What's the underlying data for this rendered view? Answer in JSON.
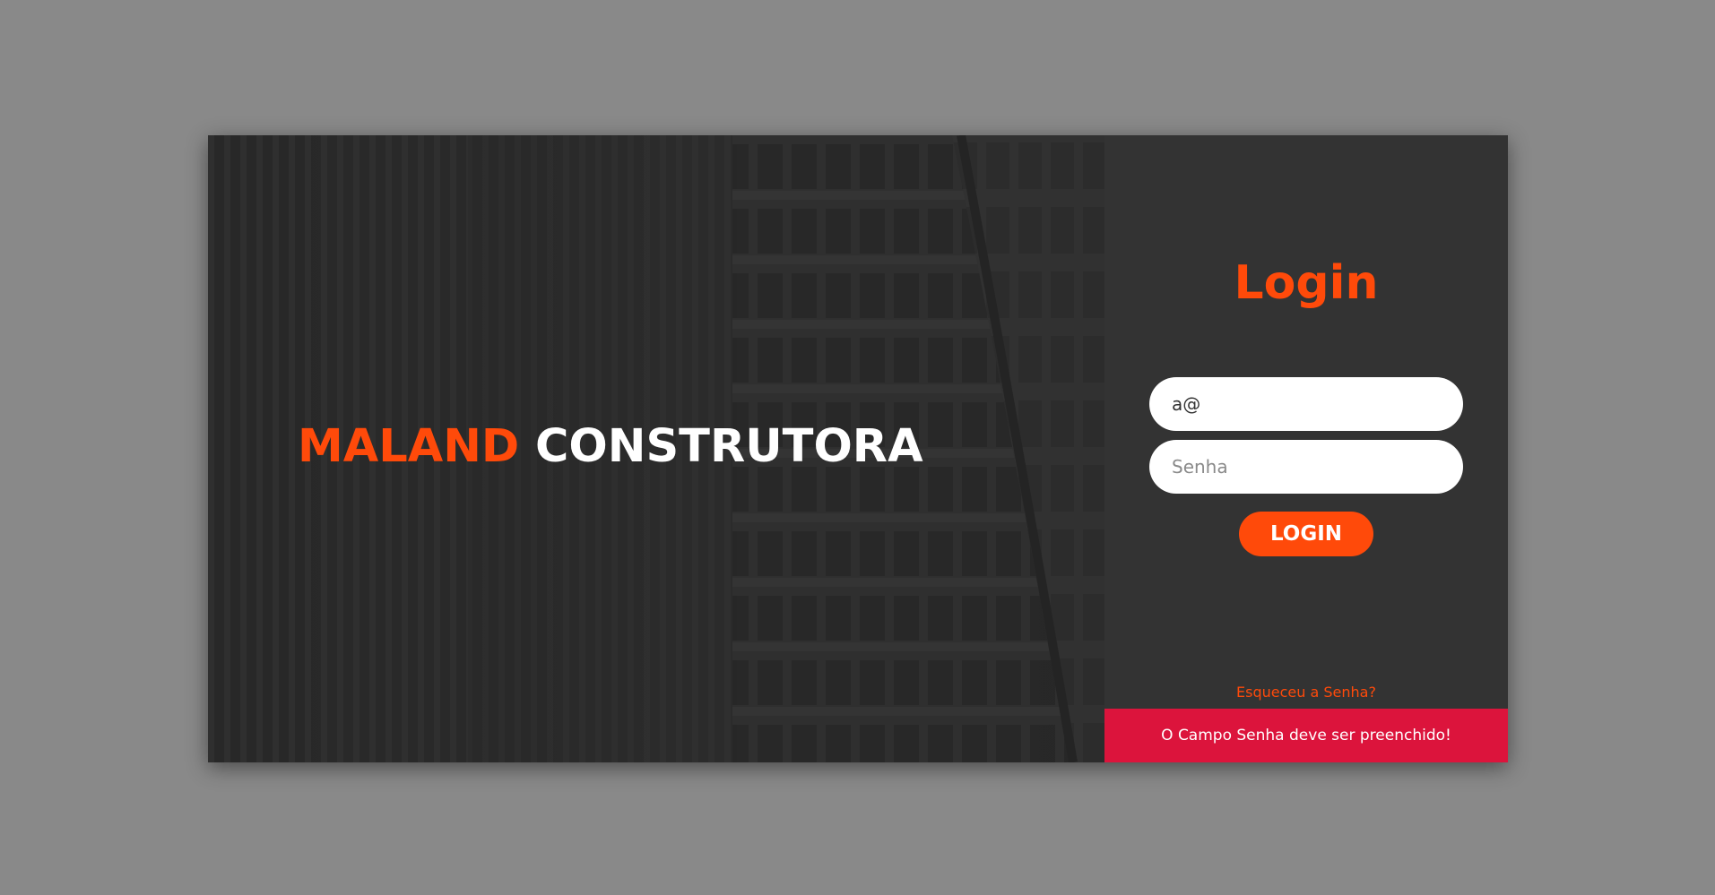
{
  "hero": {
    "brand_accent": "MALAND",
    "brand_rest": "CONSTRUTORA"
  },
  "login": {
    "heading": "Login",
    "email": {
      "value": "a@",
      "placeholder": ""
    },
    "password": {
      "value": "",
      "placeholder": "Senha"
    },
    "button_label": "LOGIN",
    "forgot_label": "Esqueceu a Senha?",
    "error_message": "O Campo Senha deve ser preenchido!"
  },
  "colors": {
    "accent": "#ff4a0a",
    "error": "#dc143c",
    "panel": "#333333",
    "page_background": "#898989"
  }
}
